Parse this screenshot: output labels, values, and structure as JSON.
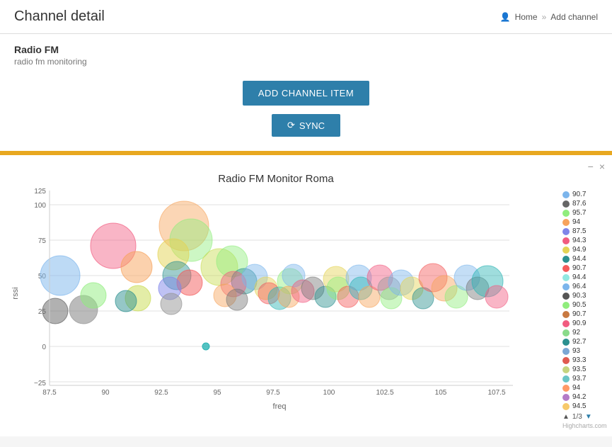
{
  "header": {
    "title": "Channel detail",
    "nav": {
      "home": "Home",
      "separator": "»",
      "current": "Add channel"
    },
    "home_icon": "👤"
  },
  "info": {
    "channel_name": "Radio FM",
    "channel_sub": "radio fm monitoring"
  },
  "buttons": {
    "add_label": "ADD CHANNEL ITEM",
    "sync_label": "SYNC",
    "sync_icon": "⟳"
  },
  "chart": {
    "title": "Radio FM Monitor Roma",
    "x_label": "freq",
    "y_label": "rssi",
    "controls": {
      "minimize": "−",
      "close": "×"
    },
    "legend": [
      {
        "label": "90.7",
        "color": "#7cb5ec"
      },
      {
        "label": "87.6",
        "color": "#666666"
      },
      {
        "label": "95.7",
        "color": "#90ed7d"
      },
      {
        "label": "94",
        "color": "#f7a35c"
      },
      {
        "label": "87.5",
        "color": "#8085e9"
      },
      {
        "label": "94.3",
        "color": "#f15c80"
      },
      {
        "label": "94.9",
        "color": "#e4d354"
      },
      {
        "label": "94.4",
        "color": "#2b908f"
      },
      {
        "label": "90.7",
        "color": "#f45b5b"
      },
      {
        "label": "94.4",
        "color": "#91e8e1"
      },
      {
        "label": "96.4",
        "color": "#7cb5ec"
      },
      {
        "label": "90.3",
        "color": "#555"
      },
      {
        "label": "90.5",
        "color": "#90ed7d"
      },
      {
        "label": "90.7",
        "color": "#c87941"
      },
      {
        "label": "90.9",
        "color": "#f15c80"
      },
      {
        "label": "92",
        "color": "#8adb8a"
      },
      {
        "label": "92.7",
        "color": "#2b908f"
      },
      {
        "label": "93",
        "color": "#7ba7d4"
      },
      {
        "label": "93.3",
        "color": "#e05a50"
      },
      {
        "label": "93.5",
        "color": "#c5d47e"
      },
      {
        "label": "93.7",
        "color": "#6ac5c5"
      },
      {
        "label": "94",
        "color": "#ff9966"
      },
      {
        "label": "94.2",
        "color": "#b47bc7"
      },
      {
        "label": "94.5",
        "color": "#f7c96a"
      }
    ],
    "pagination": "1/3",
    "credit": "Highcharts.com"
  }
}
